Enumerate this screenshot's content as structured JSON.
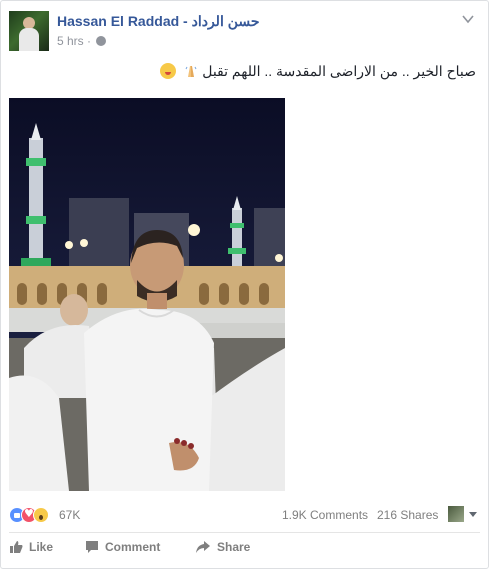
{
  "post": {
    "author": "Hassan El Raddad - حسن الرداد",
    "timestamp": "5 hrs",
    "meta_sep": "·",
    "text": "صباح الخير .. من الاراضى المقدسة .. اللهم تقبل",
    "reaction_count": "67K",
    "comments": "1.9K Comments",
    "shares": "216 Shares"
  },
  "actions": {
    "like": "Like",
    "comment": "Comment",
    "share": "Share"
  },
  "icons": [
    "avatar",
    "globe-icon",
    "chevron-down-icon",
    "praying-hands-icon",
    "blowing-kiss-emoji-icon",
    "like-reaction-icon",
    "love-reaction-icon",
    "wow-reaction-icon",
    "like-icon",
    "comment-icon",
    "share-icon"
  ],
  "colors": {
    "author_link": "#365899",
    "meta": "#90949c",
    "action_text": "#7f7f7f",
    "like_reaction": "#5890ff",
    "love_reaction": "#f25268",
    "wow_reaction": "#f7c948"
  }
}
